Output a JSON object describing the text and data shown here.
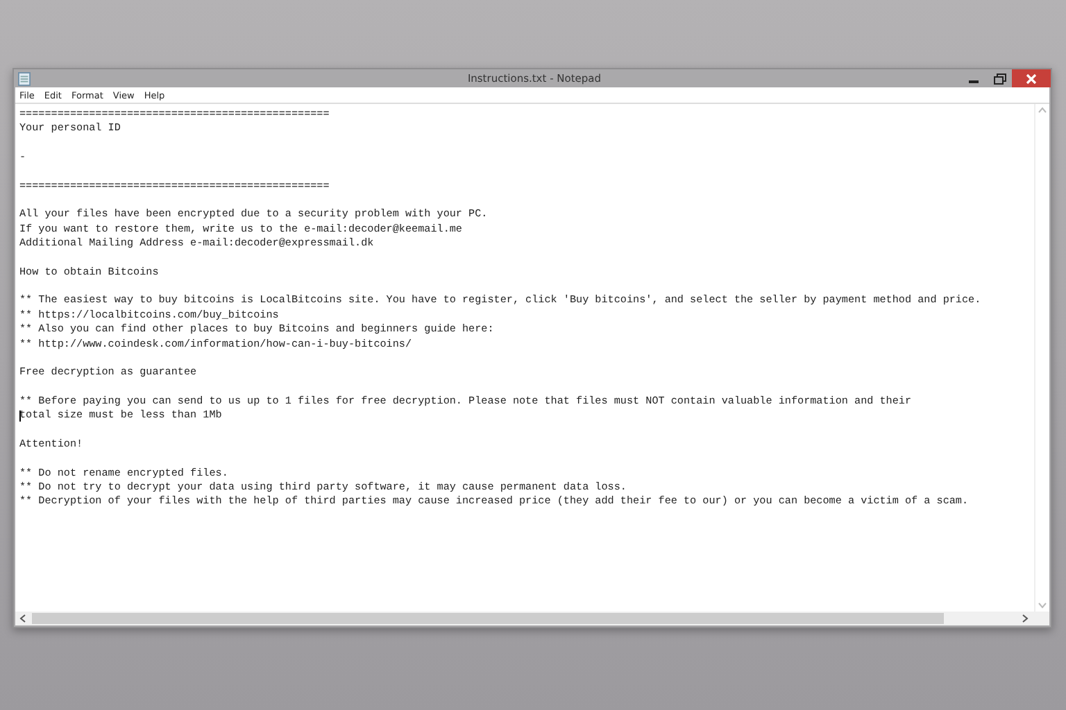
{
  "window": {
    "title": "Instructions.txt - Notepad"
  },
  "menu": [
    "File",
    "Edit",
    "Format",
    "View",
    "Help"
  ],
  "document": {
    "blocks": [
      [
        "=================================================",
        "Your personal ID"
      ],
      [
        "-"
      ],
      [
        "================================================="
      ],
      [
        "All your files have been encrypted due to a security problem with your PC.",
        "If you want to restore them, write us to the e-mail:decoder@keemail.me",
        "Additional Mailing Address e-mail:decoder@expressmail.dk"
      ],
      [
        "How to obtain Bitcoins"
      ],
      [
        "** The easiest way to buy bitcoins is LocalBitcoins site. You have to register, click 'Buy bitcoins', and select the seller by payment method and price.",
        "** https://localbitcoins.com/buy_bitcoins",
        "** Also you can find other places to buy Bitcoins and beginners guide here:",
        "** http://www.coindesk.com/information/how-can-i-buy-bitcoins/"
      ],
      [
        "Free decryption as guarantee"
      ],
      [
        "** Before paying you can send to us up to 1 files for free decryption. Please note that files must NOT contain valuable information and their",
        "total size must be less than 1Mb"
      ],
      [
        "Attention!"
      ],
      [
        "** Do not rename encrypted files.",
        "** Do not try to decrypt your data using third party software, it may cause permanent data loss.",
        "** Decryption of your files with the help of third parties may cause increased price (they add their fee to our) or you can become a victim of a scam."
      ]
    ]
  }
}
